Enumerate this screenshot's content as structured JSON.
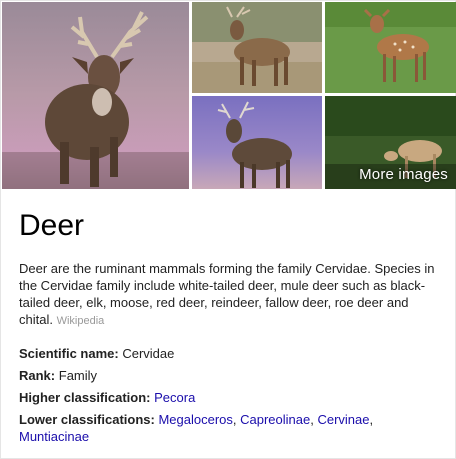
{
  "images": {
    "more_label": "More images"
  },
  "title": "Deer",
  "description": {
    "text": "Deer are the ruminant mammals forming the family Cervidae. Species in the Cervidae family include white-tailed deer, mule deer such as black-tailed deer, elk, moose, red deer, reindeer, fallow deer, roe deer and chital.",
    "source": "Wikipedia"
  },
  "facts": {
    "scientific_name": {
      "label": "Scientific name:",
      "value": "Cervidae"
    },
    "rank": {
      "label": "Rank:",
      "value": "Family"
    },
    "higher_classification": {
      "label": "Higher classification:",
      "value": "Pecora"
    },
    "lower_classifications": {
      "label": "Lower classifications:",
      "links": [
        "Megaloceros",
        "Capreolinae",
        "Cervinae",
        "Muntiacinae"
      ]
    }
  },
  "colors": {
    "link": "#1a0dab",
    "source": "#999999"
  }
}
